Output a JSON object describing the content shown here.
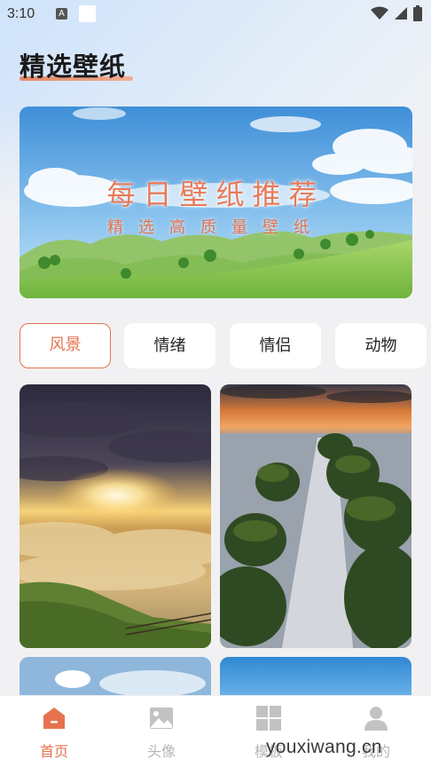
{
  "status_bar": {
    "time": "3:10",
    "notification_icon": "A"
  },
  "page": {
    "title": "精选壁纸"
  },
  "banner": {
    "title": "每日壁纸推荐",
    "subtitle": "精选高质量壁纸"
  },
  "tabs": [
    {
      "label": "风景",
      "active": true
    },
    {
      "label": "情绪",
      "active": false
    },
    {
      "label": "情侣",
      "active": false
    },
    {
      "label": "动物",
      "active": false
    }
  ],
  "bottom_nav": [
    {
      "label": "首页",
      "icon": "home-icon",
      "active": true
    },
    {
      "label": "头像",
      "icon": "image-icon",
      "active": false
    },
    {
      "label": "模板",
      "icon": "grid-icon",
      "active": false
    },
    {
      "label": "我的",
      "icon": "user-icon",
      "active": false
    }
  ],
  "watermark": "youxiwang.cn",
  "colors": {
    "accent": "#e5734f",
    "inactive": "#b5b5b5"
  }
}
